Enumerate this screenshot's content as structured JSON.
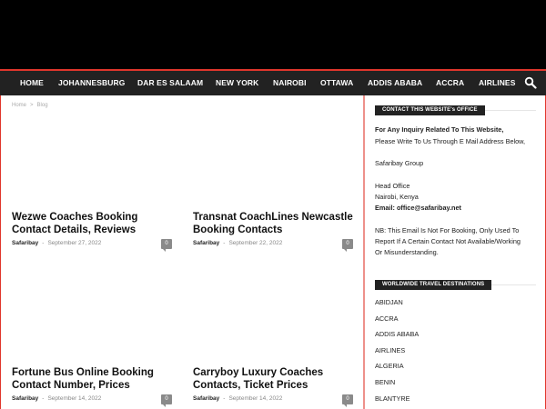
{
  "nav": {
    "items": [
      "HOME",
      "JOHANNESBURG",
      "DAR ES SALAAM",
      "NEW YORK",
      "NAIROBI",
      "OTTAWA",
      "ADDIS ABABA",
      "ACCRA",
      "AIRLINES"
    ],
    "search_icon": "search-icon"
  },
  "breadcrumb": {
    "home": "Home",
    "separator": ">",
    "current": "Blog"
  },
  "posts": [
    {
      "title_line1": "Wezwe Coaches Booking",
      "title_line2": "Contact Details, Reviews",
      "author": "Safaribay",
      "date": "September 27, 2022",
      "comments": "0"
    },
    {
      "title_line1": "Transnat CoachLines Newcastle",
      "title_line2": "Booking Contacts",
      "author": "Safaribay",
      "date": "September 22, 2022",
      "comments": "0"
    },
    {
      "title_line1": "Fortune Bus Online Booking",
      "title_line2": "Contact Number, Prices",
      "author": "Safaribay",
      "date": "September 14, 2022",
      "comments": "0"
    },
    {
      "title_line1": "Carryboy Luxury Coaches",
      "title_line2": "Contacts, Ticket Prices",
      "author": "Safaribay",
      "date": "September 14, 2022",
      "comments": "0"
    }
  ],
  "meta_dash": "-",
  "contact_widget": {
    "title": "CONTACT THIS WEBSITE's OFFICE",
    "inquiry_line1": "For Any Inquiry Related To This Website,",
    "inquiry_line2": "Please Write To Us Through E Mail Address Below,",
    "company": "Safaribay Group",
    "office_label": "Head Office",
    "office_location": "Nairobi, Kenya",
    "email_label": "Email",
    "email_colon": ":",
    "email_value": "office@safaribay.net",
    "note_line1": "NB: This Email Is Not For Booking, Only Used To",
    "note_line2": "Report If A Certain Contact Not Available/Working",
    "note_line3": "Or Misunderstanding."
  },
  "destinations_widget": {
    "title": "WORLDWIDE TRAVEL DESTINATIONS",
    "items": [
      "ABIDJAN",
      "ACCRA",
      "ADDIS ABABA",
      "AIRLINES",
      "ALGERIA",
      "BENIN",
      "BLANTYRE"
    ]
  },
  "colors": {
    "accent": "#e0362c",
    "nav_bg": "#222222",
    "header_bg": "#000000"
  }
}
